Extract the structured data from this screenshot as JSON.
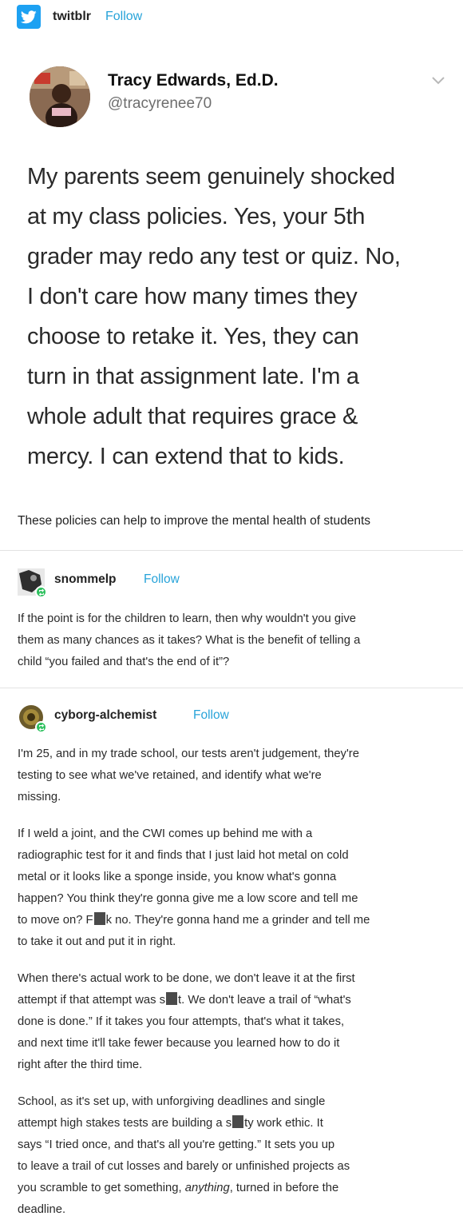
{
  "header": {
    "source_name": "twitblr",
    "follow_label": "Follow",
    "icon": "twitter-bird-icon",
    "accent": "#1da1f2"
  },
  "tweet": {
    "display_name": "Tracy Edwards, Ed.D.",
    "handle": "@tracyrenee70",
    "chevron_icon": "chevron-down-icon",
    "lines": [
      "My parents seem genuinely shocked",
      "at my class policies. Yes, your 5th",
      "grader may redo any test or quiz. No,",
      "I don't care how many times they",
      "choose to retake it. Yes, they can",
      "turn in that assignment late. I'm a",
      "whole adult that requires grace &",
      "mercy. I can extend that to kids."
    ]
  },
  "caption": "These policies can help to improve the mental health of students",
  "reblogs": [
    {
      "username": "snommelp",
      "follow_label": "Follow",
      "paragraphs": [
        [
          "If the point is for the children to learn, then why wouldn't you give",
          "them as many chances as it takes? What is the benefit of telling a",
          "child “you failed and that's the end of it”?"
        ]
      ]
    },
    {
      "username": "cyborg-alchemist",
      "follow_label": "Follow",
      "p1": [
        "I'm 25, and in my trade school, our tests aren't judgement, they're",
        "testing to see what we've retained, and identify what we're",
        "missing."
      ],
      "p2": [
        "If I weld a joint, and the CWI comes up behind me with a",
        "radiographic test for it and finds that I just laid hot metal on cold",
        "metal or it looks like a sponge inside, you know what's gonna",
        "happen? You think they're gonna give me a low score and tell me"
      ],
      "p2_l5_a": "to move on? F",
      "p2_l5_b": "k no. They're gonna hand me a grinder and tell me",
      "p2_l6": "to take it out and put it in right.",
      "p3_l1": "When there's actual work to be done, we don't leave it at the first",
      "p3_l2_a": "attempt if that attempt was s",
      "p3_l2_b": "t. We don't leave a trail of “what's",
      "p3_rest": [
        "done is done.” If it takes you four attempts, that's what it takes,",
        "and next time it'll take fewer because you learned how to do it",
        "right after the third time."
      ],
      "p4_l1": "School, as it's set up, with unforgiving deadlines and single",
      "p4_l2_a": "attempt high stakes tests are building a s",
      "p4_l2_b": "ty work ethic. It",
      "p4_l3": "says “I tried once, and that's all you're getting.” It sets you up",
      "p4_l4": "to leave a trail of cut losses and barely or unfinished projects as",
      "p4_l5_a": "you scramble to get something, ",
      "p4_l5_em": "anything",
      "p4_l5_b": ", turned in before the",
      "p4_l6": "deadline."
    }
  ]
}
